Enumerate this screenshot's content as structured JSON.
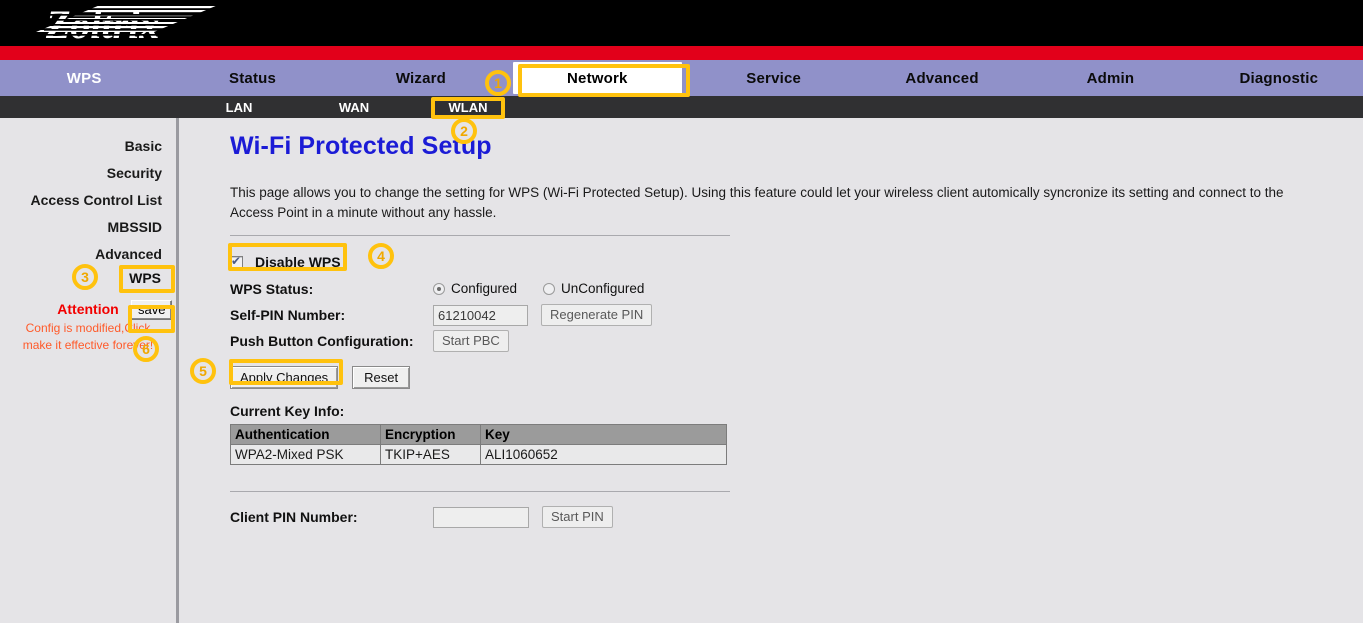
{
  "brand": {
    "logo_text": "Zoltrix"
  },
  "mainnav": [
    {
      "label": "WPS",
      "selected": false,
      "style": "white"
    },
    {
      "label": "Status",
      "selected": false,
      "style": "dark"
    },
    {
      "label": "Wizard",
      "selected": false,
      "style": "dark"
    },
    {
      "label": "Network",
      "selected": true,
      "style": "dark"
    },
    {
      "label": "Service",
      "selected": false,
      "style": "dark"
    },
    {
      "label": "Advanced",
      "selected": false,
      "style": "dark"
    },
    {
      "label": "Admin",
      "selected": false,
      "style": "dark"
    },
    {
      "label": "Diagnostic",
      "selected": false,
      "style": "dark"
    }
  ],
  "subnav": [
    {
      "label": "LAN",
      "selected": false
    },
    {
      "label": "WAN",
      "selected": false
    },
    {
      "label": "WLAN",
      "selected": true
    }
  ],
  "sidebar": {
    "items": [
      {
        "label": "Basic"
      },
      {
        "label": "Security"
      },
      {
        "label": "Access Control List"
      },
      {
        "label": "MBSSID"
      },
      {
        "label": "Advanced"
      },
      {
        "label": "WPS"
      }
    ],
    "attention_title": "Attention",
    "attention_line1": "Config is modified,Click",
    "attention_line2": "make it effective forever!",
    "save_label": "save"
  },
  "main": {
    "title": "Wi-Fi Protected Setup",
    "description": "This page allows you to change the setting for WPS (Wi-Fi Protected Setup). Using this feature could let your wireless client automically syncronize its setting and connect to the Access Point in a minute without any hassle.",
    "disable_wps_label": "Disable WPS",
    "disable_wps_checked": true,
    "wps_status_label": "WPS Status:",
    "status_options": [
      {
        "label": "Configured",
        "selected": true
      },
      {
        "label": "UnConfigured",
        "selected": false
      }
    ],
    "self_pin_label": "Self-PIN Number:",
    "self_pin_value": "61210042",
    "regenerate_pin_label": "Regenerate PIN",
    "pbc_label": "Push Button Configuration:",
    "start_pbc_label": "Start PBC",
    "apply_label": "Apply Changes",
    "reset_label": "Reset",
    "key_info_label": "Current Key Info:",
    "key_table": {
      "headers": [
        "Authentication",
        "Encryption",
        "Key"
      ],
      "rows": [
        [
          "WPA2-Mixed PSK",
          "TKIP+AES",
          "ALI1060652"
        ]
      ]
    },
    "client_pin_label": "Client PIN Number:",
    "client_pin_value": "",
    "client_pin_placeholder": "",
    "start_pin_label": "Start PIN"
  },
  "annotations": {
    "markers": [
      "1",
      "2",
      "3",
      "4",
      "5",
      "6"
    ],
    "highlight_color": "#ffc20e"
  },
  "colors": {
    "header_bg": "#000000",
    "red_bar": "#e2001a",
    "nav_bg": "#9091c9",
    "subnav_bg": "#303032",
    "page_bg": "#e5e4e7",
    "title_blue": "#1b1bd6",
    "attention_red": "#f20000"
  }
}
